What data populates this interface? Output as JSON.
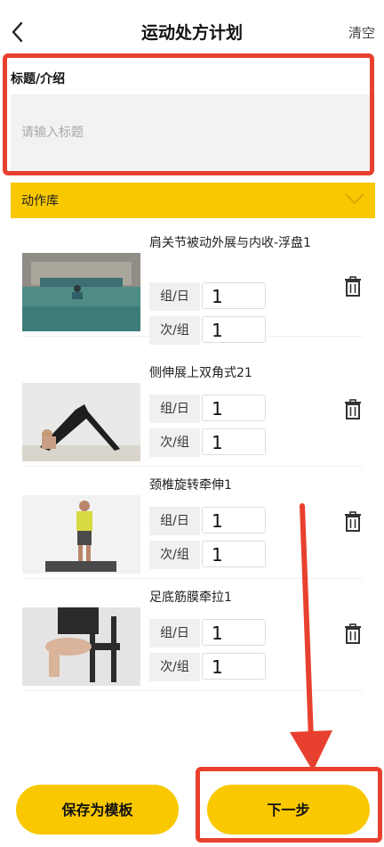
{
  "header": {
    "title": "运动处方计划",
    "clear_label": "清空"
  },
  "title_field": {
    "label": "标题/介绍",
    "placeholder": "请输入标题",
    "value": ""
  },
  "library": {
    "label": "动作库"
  },
  "exercises": [
    {
      "name": "肩关节被动外展与内收-浮盘1",
      "sets_label": "组/日",
      "sets_value": "1",
      "reps_label": "次/组",
      "reps_value": "1",
      "thumb": "pool"
    },
    {
      "name": "侧伸展上双角式21",
      "sets_label": "组/日",
      "sets_value": "1",
      "reps_label": "次/组",
      "reps_value": "1",
      "thumb": "yoga"
    },
    {
      "name": "颈椎旋转牵伸1",
      "sets_label": "组/日",
      "sets_value": "1",
      "reps_label": "次/组",
      "reps_value": "1",
      "thumb": "standing"
    },
    {
      "name": "足底筋膜牵拉1",
      "sets_label": "组/日",
      "sets_value": "1",
      "reps_label": "次/组",
      "reps_value": "1",
      "thumb": "chair"
    }
  ],
  "footer": {
    "save_template_label": "保存为模板",
    "next_label": "下一步"
  },
  "colors": {
    "accent": "#f9c800",
    "highlight": "#e8402e"
  }
}
